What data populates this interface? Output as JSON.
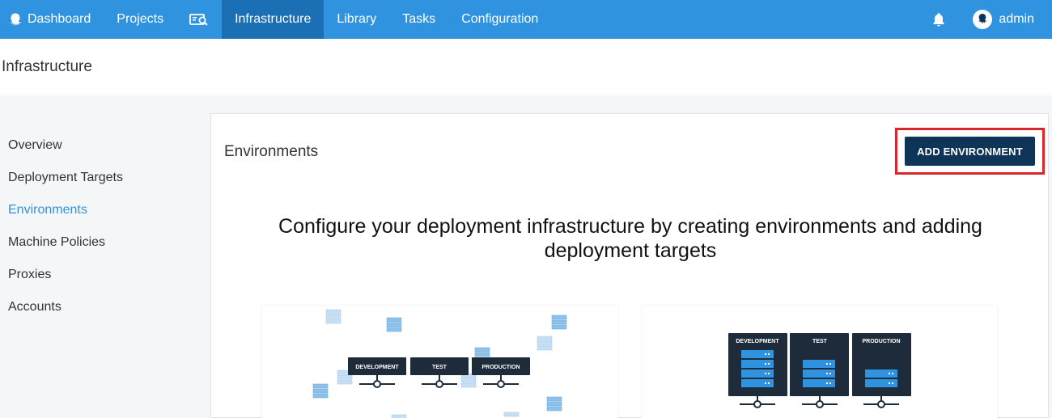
{
  "nav": {
    "items": [
      {
        "label": "Dashboard",
        "icon": "octopus-logo-icon"
      },
      {
        "label": "Projects"
      },
      {
        "label": "",
        "icon": "search-icon"
      },
      {
        "label": "Infrastructure",
        "active": true
      },
      {
        "label": "Library"
      },
      {
        "label": "Tasks"
      },
      {
        "label": "Configuration"
      }
    ],
    "notifications_icon": "bell-icon",
    "user": {
      "name": "admin",
      "icon": "avatar-icon"
    },
    "color": "#2f93e0",
    "active_color": "#1a6fb5"
  },
  "page": {
    "title": "Infrastructure"
  },
  "sidebar": {
    "items": [
      {
        "label": "Overview"
      },
      {
        "label": "Deployment Targets"
      },
      {
        "label": "Environments",
        "active": true
      },
      {
        "label": "Machine Policies"
      },
      {
        "label": "Proxies"
      },
      {
        "label": "Accounts"
      }
    ]
  },
  "main": {
    "title": "Environments",
    "add_button": "ADD ENVIRONMENT",
    "hero_line1": "Configure your deployment infrastructure by creating environments and adding",
    "hero_line2": "deployment targets",
    "illustration_left": {
      "labels": [
        "DEVELOPMENT",
        "TEST",
        "PRODUCTION"
      ]
    },
    "illustration_right": {
      "labels": [
        "DEVELOPMENT",
        "TEST",
        "PRODUCTION"
      ]
    },
    "button_color": "#0e3458",
    "highlight_color": "#d9262b"
  }
}
